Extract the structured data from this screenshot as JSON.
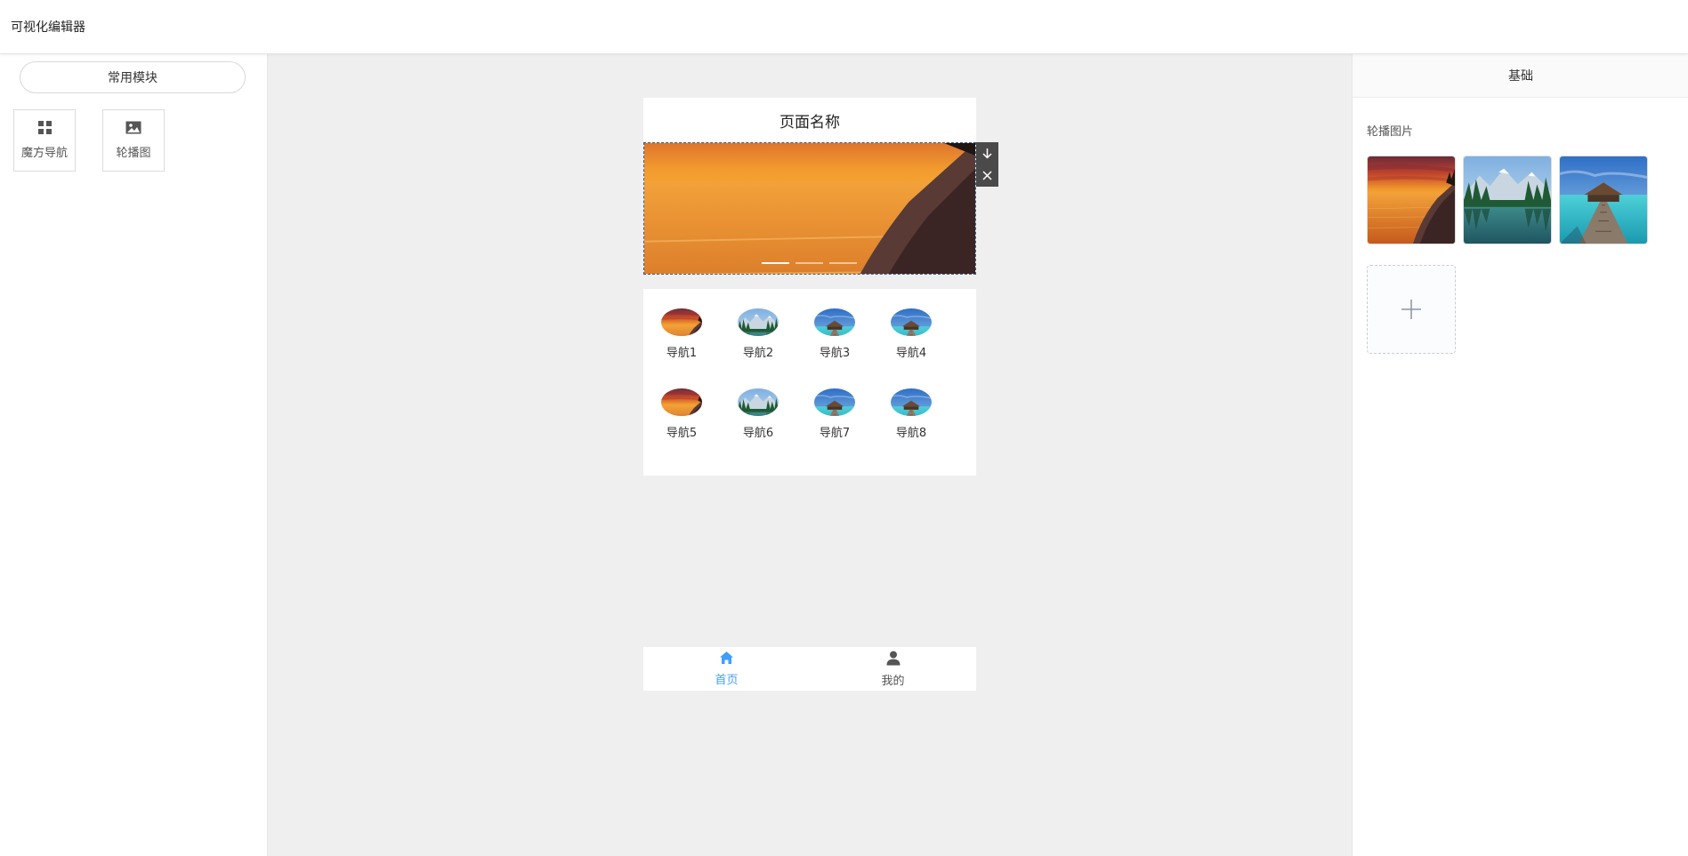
{
  "app": {
    "title": "可视化编辑器"
  },
  "left_panel": {
    "tab_label": "常用模块",
    "widgets": [
      {
        "label": "魔方导航",
        "icon": "grid-icon"
      },
      {
        "label": "轮播图",
        "icon": "image-icon"
      }
    ]
  },
  "preview": {
    "page_title": "页面名称",
    "carousel": {
      "slide_count": 3,
      "active_index": 0
    },
    "carousel_tools": [
      "move-down-icon",
      "close-icon"
    ],
    "nav_items": [
      {
        "label": "导航1",
        "image": "sunset"
      },
      {
        "label": "导航2",
        "image": "lake"
      },
      {
        "label": "导航3",
        "image": "pier"
      },
      {
        "label": "导航4",
        "image": "pier"
      },
      {
        "label": "导航5",
        "image": "sunset"
      },
      {
        "label": "导航6",
        "image": "lake"
      },
      {
        "label": "导航7",
        "image": "pier"
      },
      {
        "label": "导航8",
        "image": "pier"
      }
    ],
    "tabbar": [
      {
        "label": "首页",
        "icon": "home-icon",
        "active": true
      },
      {
        "label": "我的",
        "icon": "user-icon",
        "active": false
      }
    ]
  },
  "right_panel": {
    "tab_label": "基础",
    "carousel_label": "轮播图片",
    "images": [
      "sunset",
      "lake",
      "pier"
    ],
    "add_icon": "plus-icon"
  },
  "colors": {
    "accent": "#409eff",
    "canvas_bg": "#efefef",
    "tool_bg": "#4a4a4a"
  }
}
